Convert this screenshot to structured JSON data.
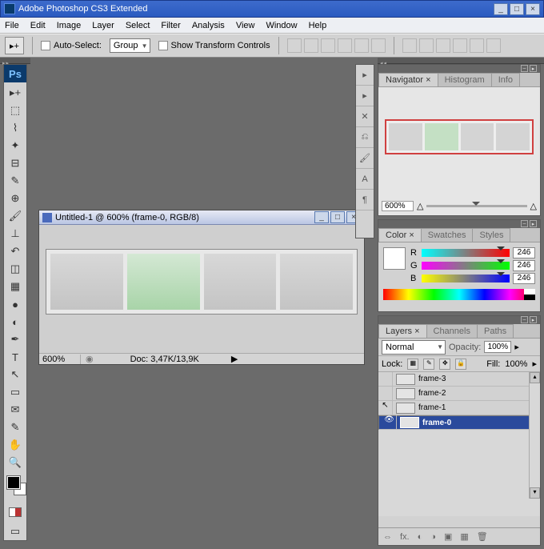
{
  "app_title": "Adobe Photoshop CS3 Extended",
  "menu": [
    "File",
    "Edit",
    "Image",
    "Layer",
    "Select",
    "Filter",
    "Analysis",
    "View",
    "Window",
    "Help"
  ],
  "options": {
    "auto_select": "Auto-Select:",
    "group": "Group",
    "show_transform": "Show Transform Controls"
  },
  "doc": {
    "title": "Untitled-1 @ 600% (frame-0, RGB/8)",
    "zoom": "600%",
    "info": "Doc: 3,47K/13,9K"
  },
  "nav": {
    "tabs": [
      "Navigator ×",
      "Histogram",
      "Info"
    ],
    "zoom": "600%"
  },
  "color": {
    "tabs": [
      "Color ×",
      "Swatches",
      "Styles"
    ],
    "r": "R",
    "g": "G",
    "b": "B",
    "rv": "246",
    "gv": "246",
    "bv": "246"
  },
  "layers": {
    "tabs": [
      "Layers ×",
      "Channels",
      "Paths"
    ],
    "blend": "Normal",
    "opacity_lbl": "Opacity:",
    "opacity": "100%",
    "lock": "Lock:",
    "fill_lbl": "Fill:",
    "fill": "100%",
    "items": [
      {
        "name": "frame-3",
        "eye": ""
      },
      {
        "name": "frame-2",
        "eye": ""
      },
      {
        "name": "frame-1",
        "eye": ""
      },
      {
        "name": "frame-0",
        "eye": "👁"
      }
    ]
  }
}
